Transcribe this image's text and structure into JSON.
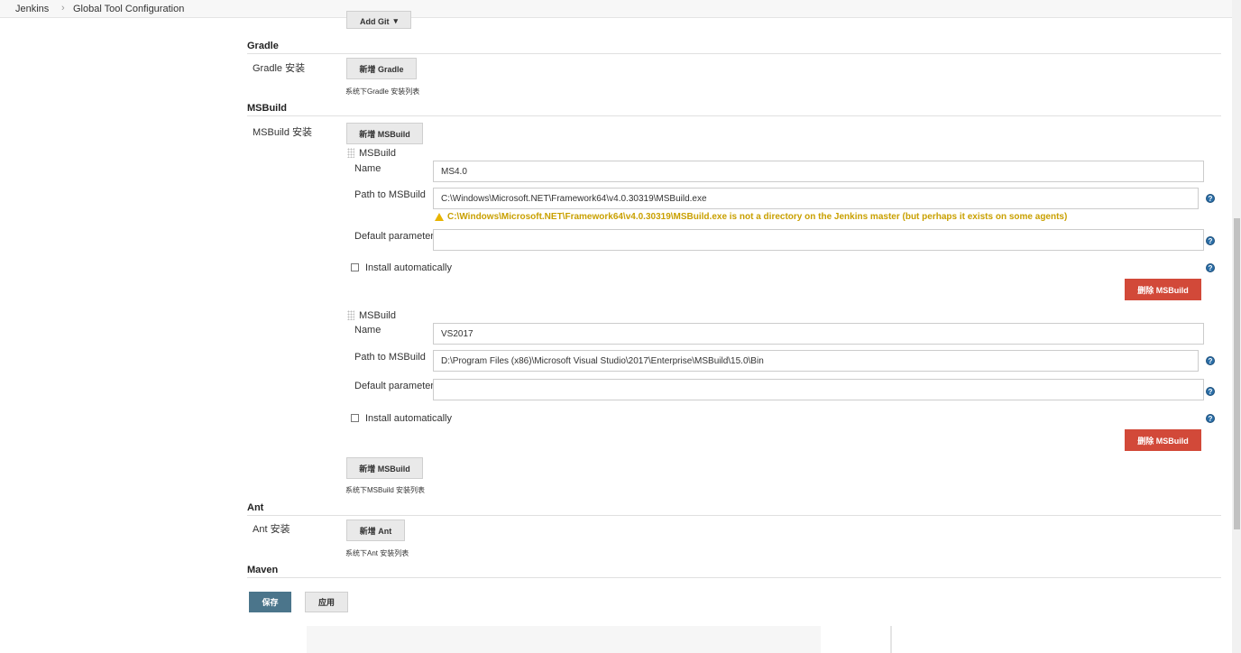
{
  "breadcrumb": {
    "home": "Jenkins",
    "sep": "›",
    "page": "Global Tool Configuration"
  },
  "git": {
    "add_button": "Add Git"
  },
  "gradle": {
    "title": "Gradle",
    "install_label": "Gradle 安装",
    "add_button": "新增 Gradle",
    "description": "系统下Gradle 安装列表"
  },
  "msbuild": {
    "title": "MSBuild",
    "install_label": "MSBuild 安装",
    "add_button_top": "新增 MSBuild",
    "add_button_bottom": "新增 MSBuild",
    "description": "系统下MSBuild 安装列表",
    "installations": [
      {
        "header": "MSBuild",
        "name_label": "Name",
        "name_value": "MS4.0",
        "path_label": "Path to MSBuild",
        "path_value": "C:\\Windows\\Microsoft.NET\\Framework64\\v4.0.30319\\MSBuild.exe",
        "warning": "C:\\Windows\\Microsoft.NET\\Framework64\\v4.0.30319\\MSBuild.exe is not a directory on the Jenkins master (but perhaps it exists on some agents)",
        "params_label": "Default parameters",
        "params_value": "",
        "auto_label": "Install automatically",
        "delete_button": "删除 MSBuild"
      },
      {
        "header": "MSBuild",
        "name_label": "Name",
        "name_value": "VS2017",
        "path_label": "Path to MSBuild",
        "path_value": "D:\\Program Files (x86)\\Microsoft Visual Studio\\2017\\Enterprise\\MSBuild\\15.0\\Bin",
        "params_label": "Default parameters",
        "params_value": "",
        "auto_label": "Install automatically",
        "delete_button": "删除 MSBuild"
      }
    ]
  },
  "ant": {
    "title": "Ant",
    "install_label": "Ant 安装",
    "add_button": "新增 Ant",
    "description": "系统下Ant 安装列表"
  },
  "maven": {
    "title": "Maven"
  },
  "footer": {
    "save": "保存",
    "apply": "应用"
  },
  "colors": {
    "delete": "#d24939",
    "save": "#4b758b",
    "warning": "#c9a000",
    "help": "#2b6fa8"
  }
}
